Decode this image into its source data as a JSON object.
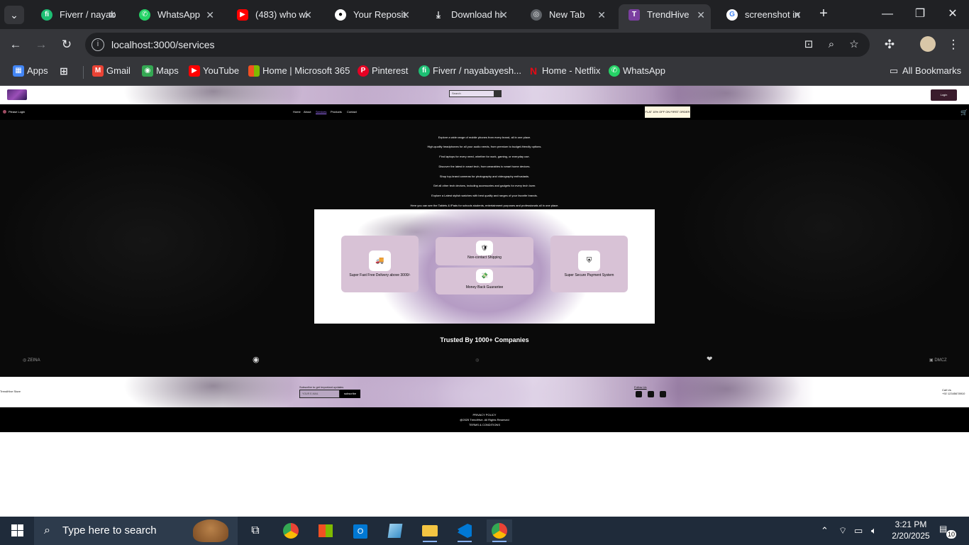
{
  "browser": {
    "tabs": [
      {
        "title": "Fiverr / nayab",
        "icon": "fiverr-icon",
        "color": "#1dbf73"
      },
      {
        "title": "WhatsApp",
        "icon": "whatsapp-icon",
        "color": "#25d366"
      },
      {
        "title": "(483) who wi",
        "icon": "youtube-icon",
        "color": "#ff0000"
      },
      {
        "title": "Your Reposit",
        "icon": "github-icon",
        "color": "#ffffff"
      },
      {
        "title": "Download hi",
        "icon": "download-icon",
        "color": "#e8eaed"
      },
      {
        "title": "New Tab",
        "icon": "chrome-icon",
        "color": "#e8eaed"
      },
      {
        "title": "TrendHive",
        "icon": "trendhive-icon",
        "color": "#7b3fa0"
      },
      {
        "title": "screenshot in",
        "icon": "google-icon",
        "color": "#4285f4"
      }
    ],
    "url": "localhost:3000/services",
    "bookmarks": [
      {
        "label": "Apps"
      },
      {
        "label": "Gmail"
      },
      {
        "label": "Maps"
      },
      {
        "label": "YouTube"
      },
      {
        "label": "Home | Microsoft 365"
      },
      {
        "label": "Pinterest"
      },
      {
        "label": "Fiverr / nayabayesh..."
      },
      {
        "label": "Home - Netflix"
      },
      {
        "label": "WhatsApp"
      }
    ],
    "all_bookmarks": "All Bookmarks"
  },
  "site": {
    "search_placeholder": "Search",
    "login_label": "Login",
    "please_login": "Please Login",
    "nav": [
      "Home",
      "About",
      "Services",
      "Products",
      "Contact"
    ],
    "active_nav": "Services",
    "promo": "FLAT 10% OFF ON FIRST ORDER",
    "descriptions": [
      "Explore a wide range of mobile phones from every brand, all in one place.",
      "High-quality headphones for all your audio needs, from premium to budget-friendly options.",
      "Find laptops for every need, whether for work, gaming, or everyday use.",
      "Discover the latest in smart tech, from wearables to smart home devices.",
      "Shop top-brand cameras for photography and videography enthusiasts.",
      "Get all other tech devices, including accessories and gadgets for every tech lover.",
      "Explore a Latest stylish watches with best quality and ranges of your favorite brands.",
      "Here you can see the Tablets & iPads for schools students, entertainment purposes and professionals all in one place."
    ],
    "services": {
      "delivery": "Super Fast Free Delivery above 3000/-",
      "shipping": "Non-contact Shipping",
      "money_back": "Money Back Guarantee",
      "payment": "Super Secure Payment System"
    },
    "trusted_heading": "Trusted By 1000+ Companies",
    "brands": [
      "ZEINA",
      "",
      "",
      "",
      "DMCZ"
    ],
    "store_name": "TrendHive Store",
    "subscribe_label": "Subscribe to get Important updates",
    "email_placeholder": "YOUR E-MAIL",
    "subscribe_button": "subscribe",
    "follow_us": "Follow Us",
    "call_label": "Call Us",
    "call_number": "+92 12345678910",
    "footer": {
      "privacy": "PRIVACY POLICY",
      "copyright": "@2025 TrendHive. All Rights Reserved",
      "terms": "TERMS & CONDITIONS"
    }
  },
  "taskbar": {
    "search_placeholder": "Type here to search",
    "time": "3:21 PM",
    "date": "2/20/2025",
    "notifications": "10"
  }
}
